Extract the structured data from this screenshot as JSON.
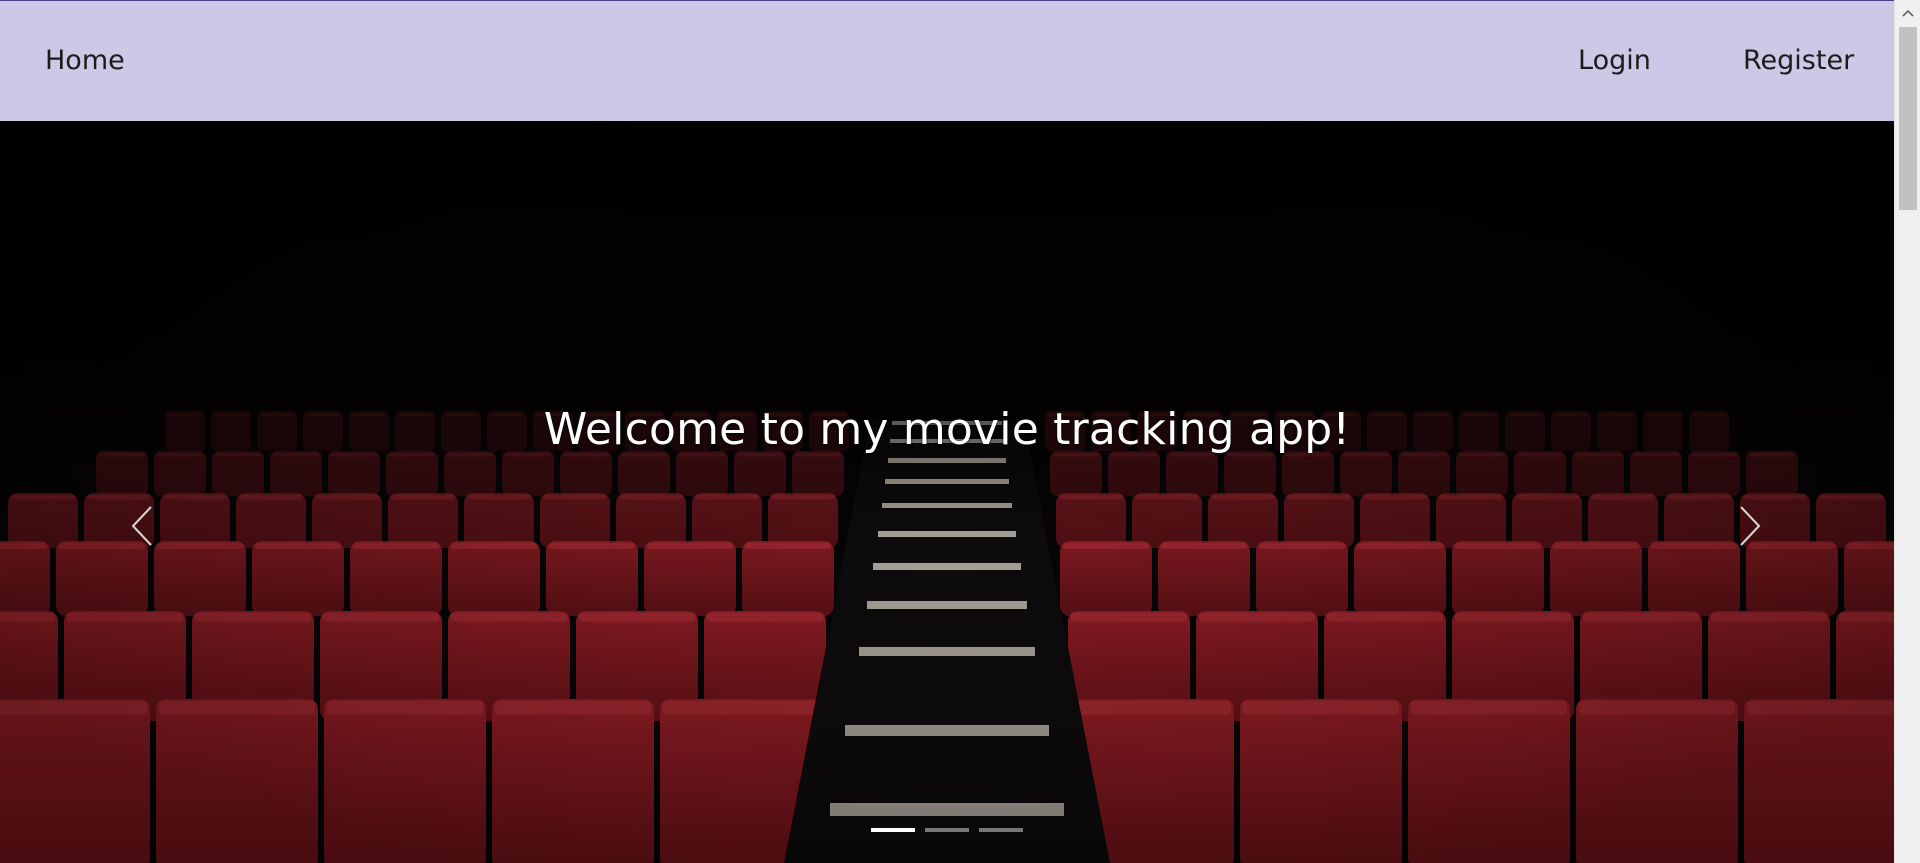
{
  "nav": {
    "home_label": "Home",
    "login_label": "Login",
    "register_label": "Register",
    "background_color": "#ccc8e6"
  },
  "hero": {
    "caption": "Welcome to my movie tracking app!",
    "image_subject": "empty cinema with red seats and lit stairs",
    "prev_icon": "chevron-left-icon",
    "next_icon": "chevron-right-icon",
    "slide_count": 3,
    "active_slide": 1
  },
  "colors": {
    "seat_red": "#8e1a22",
    "caption_text": "#ffffff"
  }
}
